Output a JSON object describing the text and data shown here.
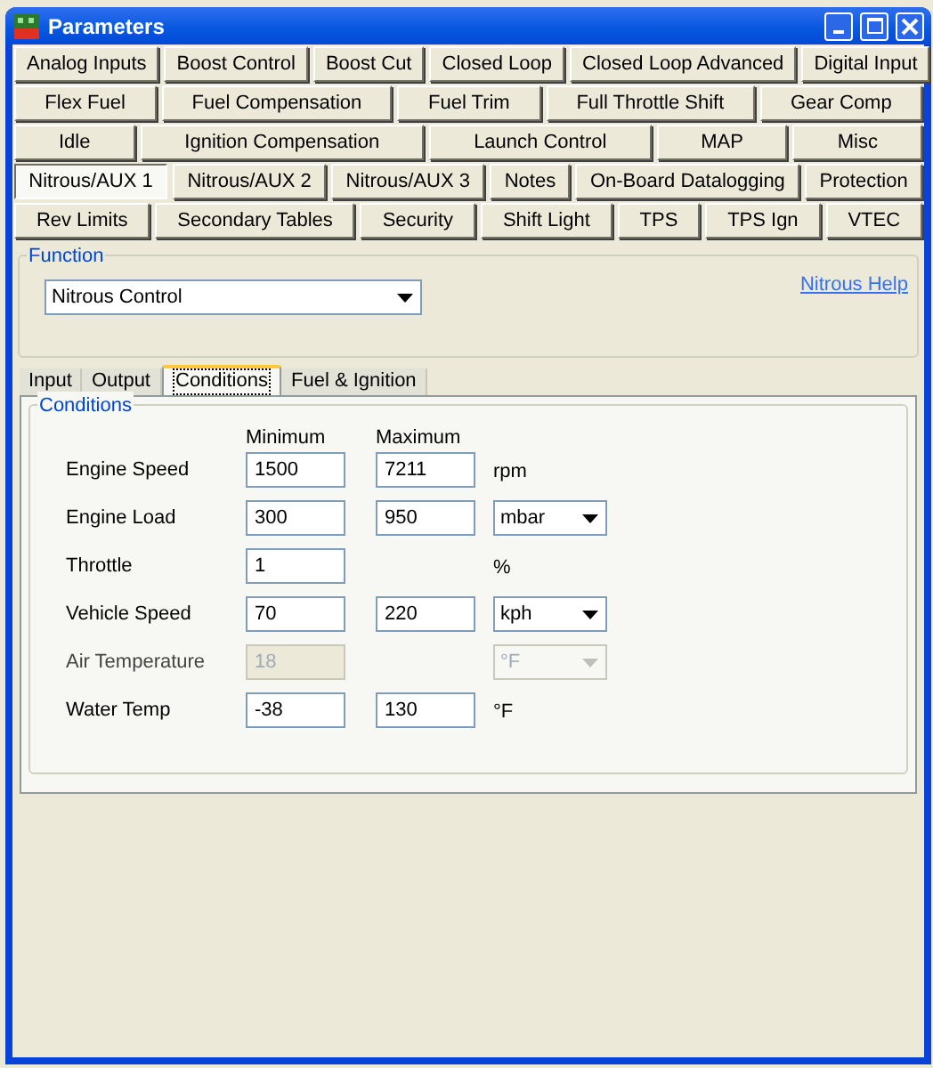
{
  "window": {
    "title": "Parameters"
  },
  "button_rows": [
    [
      {
        "label": "Analog Inputs",
        "selected": false
      },
      {
        "label": "Boost Control",
        "selected": false
      },
      {
        "label": "Boost Cut",
        "selected": false
      },
      {
        "label": "Closed Loop",
        "selected": false
      },
      {
        "label": "Closed Loop Advanced",
        "selected": false
      },
      {
        "label": "Digital Input",
        "selected": false
      }
    ],
    [
      {
        "label": "Flex Fuel",
        "selected": false
      },
      {
        "label": "Fuel Compensation",
        "selected": false
      },
      {
        "label": "Fuel Trim",
        "selected": false
      },
      {
        "label": "Full Throttle Shift",
        "selected": false
      },
      {
        "label": "Gear Comp",
        "selected": false
      }
    ],
    [
      {
        "label": "Idle",
        "selected": false
      },
      {
        "label": "Ignition Compensation",
        "selected": false
      },
      {
        "label": "Launch Control",
        "selected": false
      },
      {
        "label": "MAP",
        "selected": false
      },
      {
        "label": "Misc",
        "selected": false
      }
    ],
    [
      {
        "label": "Nitrous/AUX 1",
        "selected": true
      },
      {
        "label": "Nitrous/AUX 2",
        "selected": false
      },
      {
        "label": "Nitrous/AUX 3",
        "selected": false
      },
      {
        "label": "Notes",
        "selected": false
      },
      {
        "label": "On-Board Datalogging",
        "selected": false
      },
      {
        "label": "Protection",
        "selected": false
      }
    ],
    [
      {
        "label": "Rev Limits",
        "selected": false
      },
      {
        "label": "Secondary Tables",
        "selected": false
      },
      {
        "label": "Security",
        "selected": false
      },
      {
        "label": "Shift Light",
        "selected": false
      },
      {
        "label": "TPS",
        "selected": false
      },
      {
        "label": "TPS Ign",
        "selected": false
      },
      {
        "label": "VTEC",
        "selected": false
      }
    ]
  ],
  "function": {
    "legend": "Function",
    "value": "Nitrous Control",
    "help_link": "Nitrous Help"
  },
  "tabs": [
    {
      "label": "Input",
      "selected": false
    },
    {
      "label": "Output",
      "selected": false
    },
    {
      "label": "Conditions",
      "selected": true
    },
    {
      "label": "Fuel & Ignition",
      "selected": false
    }
  ],
  "conditions": {
    "legend": "Conditions",
    "column_headers": [
      "Minimum",
      "Maximum"
    ],
    "rows": [
      {
        "label": "Engine Speed",
        "min": "1500",
        "max": "7211",
        "unit": "rpm",
        "kind": "text",
        "disabled": false
      },
      {
        "label": "Engine Load",
        "min": "300",
        "max": "950",
        "unit": "mbar",
        "kind": "select",
        "disabled": false
      },
      {
        "label": "Throttle",
        "min": "1",
        "unit": "%",
        "kind": "text",
        "disabled": false
      },
      {
        "label": "Vehicle Speed",
        "min": "70",
        "max": "220",
        "unit": "kph",
        "kind": "select",
        "disabled": false
      },
      {
        "label": "Air Temperature",
        "min": "18",
        "unit": "°F",
        "kind": "select",
        "disabled": true
      },
      {
        "label": "Water Temp",
        "min": "-38",
        "max": "130",
        "unit": "°F",
        "kind": "text",
        "disabled": false
      }
    ]
  }
}
